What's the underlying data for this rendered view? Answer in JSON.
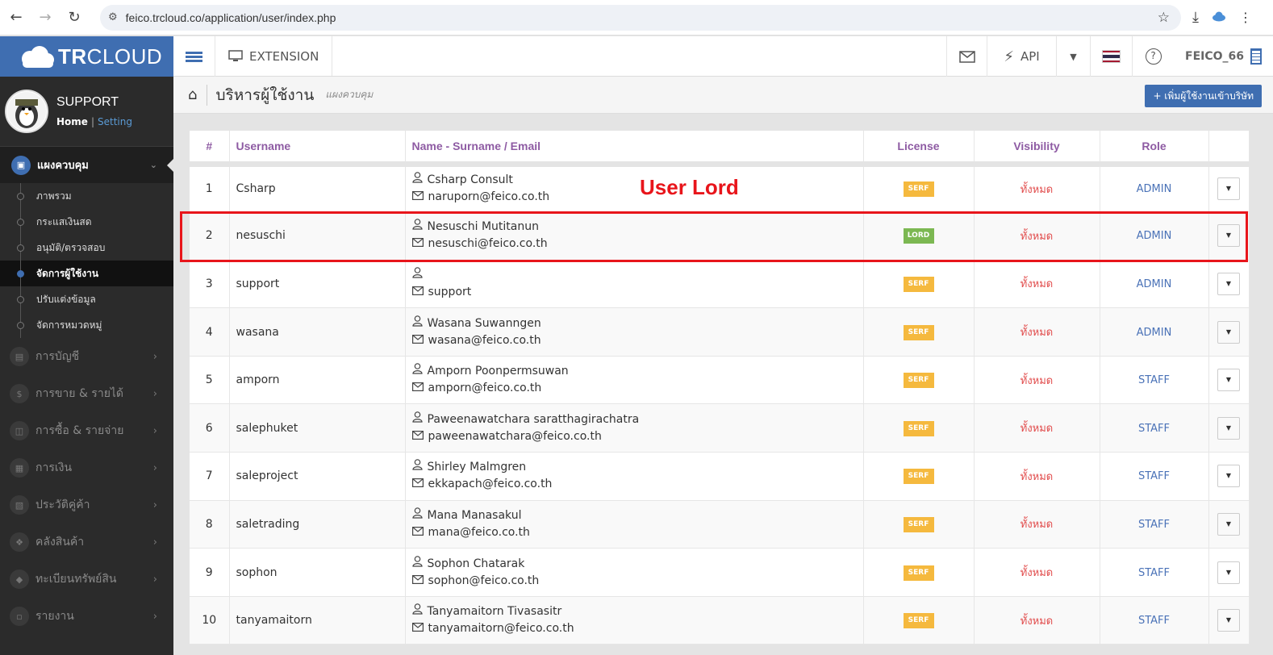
{
  "browser": {
    "url": "feico.trcloud.co/application/user/index.php"
  },
  "header": {
    "logo_text_bold": "TR",
    "logo_text": "CLOUD",
    "extension_label": "EXTENSION",
    "api_label": "API",
    "user": "FEICO_66"
  },
  "sidebar": {
    "profile_name": "SUPPORT",
    "home_link": "Home",
    "setting_link": "Setting",
    "active_menu": "แผงควบคุม",
    "submenu": [
      {
        "label": "ภาพรวม",
        "active": false
      },
      {
        "label": "กระแสเงินสด",
        "active": false
      },
      {
        "label": "อนุมัติ/ตรวจสอบ",
        "active": false
      },
      {
        "label": "จัดการผู้ใช้งาน",
        "active": true
      },
      {
        "label": "ปรับแต่งข้อมูล",
        "active": false
      },
      {
        "label": "จัดการหมวดหมู่",
        "active": false
      }
    ],
    "menu": [
      {
        "label": "การบัญชี",
        "icon": "book-icon"
      },
      {
        "label": "การขาย & รายได้",
        "icon": "dollar-icon"
      },
      {
        "label": "การซื้อ & รายจ่าย",
        "icon": "cart-icon"
      },
      {
        "label": "การเงิน",
        "icon": "calendar-icon"
      },
      {
        "label": "ประวัติคู่ค้า",
        "icon": "contact-icon"
      },
      {
        "label": "คลังสินค้า",
        "icon": "boxes-icon"
      },
      {
        "label": "ทะเบียนทรัพย์สิน",
        "icon": "diamond-icon"
      },
      {
        "label": "รายงาน",
        "icon": "report-icon"
      }
    ]
  },
  "page": {
    "title": "บริหารผู้ใช้งาน",
    "subtitle": "แผงควบคุม",
    "add_button": "+ เพิ่มผู้ใช้งานเข้าบริษัท"
  },
  "table": {
    "headers": [
      "#",
      "Username",
      "Name - Surname / Email",
      "License",
      "Visibility",
      "Role",
      ""
    ],
    "rows": [
      {
        "num": "1",
        "username": "Csharp",
        "name": "Csharp Consult",
        "email": "naruporn@feico.co.th",
        "license": "SERF",
        "license_color": "#f5b93e",
        "visibility": "ทั้งหมด",
        "role": "ADMIN"
      },
      {
        "num": "2",
        "username": "nesuschi",
        "name": "Nesuschi Mutitanun",
        "email": "nesuschi@feico.co.th",
        "license": "LORD",
        "license_color": "#7cb852",
        "visibility": "ทั้งหมด",
        "role": "ADMIN"
      },
      {
        "num": "3",
        "username": "support",
        "name": "",
        "email": "support",
        "license": "SERF",
        "license_color": "#f5b93e",
        "visibility": "ทั้งหมด",
        "role": "ADMIN"
      },
      {
        "num": "4",
        "username": "wasana",
        "name": "Wasana Suwanngen",
        "email": "wasana@feico.co.th",
        "license": "SERF",
        "license_color": "#f5b93e",
        "visibility": "ทั้งหมด",
        "role": "ADMIN"
      },
      {
        "num": "5",
        "username": "amporn",
        "name": "Amporn Poonpermsuwan",
        "email": "amporn@feico.co.th",
        "license": "SERF",
        "license_color": "#f5b93e",
        "visibility": "ทั้งหมด",
        "role": "STAFF"
      },
      {
        "num": "6",
        "username": "salephuket",
        "name": "Paweenawatchara saratthagirachatra",
        "email": "paweenawatchara@feico.co.th",
        "license": "SERF",
        "license_color": "#f5b93e",
        "visibility": "ทั้งหมด",
        "role": "STAFF"
      },
      {
        "num": "7",
        "username": "saleproject",
        "name": "Shirley Malmgren",
        "email": "ekkapach@feico.co.th",
        "license": "SERF",
        "license_color": "#f5b93e",
        "visibility": "ทั้งหมด",
        "role": "STAFF"
      },
      {
        "num": "8",
        "username": "saletrading",
        "name": "Mana Manasakul",
        "email": "mana@feico.co.th",
        "license": "SERF",
        "license_color": "#f5b93e",
        "visibility": "ทั้งหมด",
        "role": "STAFF"
      },
      {
        "num": "9",
        "username": "sophon",
        "name": "Sophon Chatarak",
        "email": "sophon@feico.co.th",
        "license": "SERF",
        "license_color": "#f5b93e",
        "visibility": "ทั้งหมด",
        "role": "STAFF"
      },
      {
        "num": "10",
        "username": "tanyamaitorn",
        "name": "Tanyamaitorn Tivasasitr",
        "email": "tanyamaitorn@feico.co.th",
        "license": "SERF",
        "license_color": "#f5b93e",
        "visibility": "ทั้งหมด",
        "role": "STAFF"
      }
    ]
  },
  "annotation": {
    "text": "User Lord",
    "color": "#e8151b"
  }
}
